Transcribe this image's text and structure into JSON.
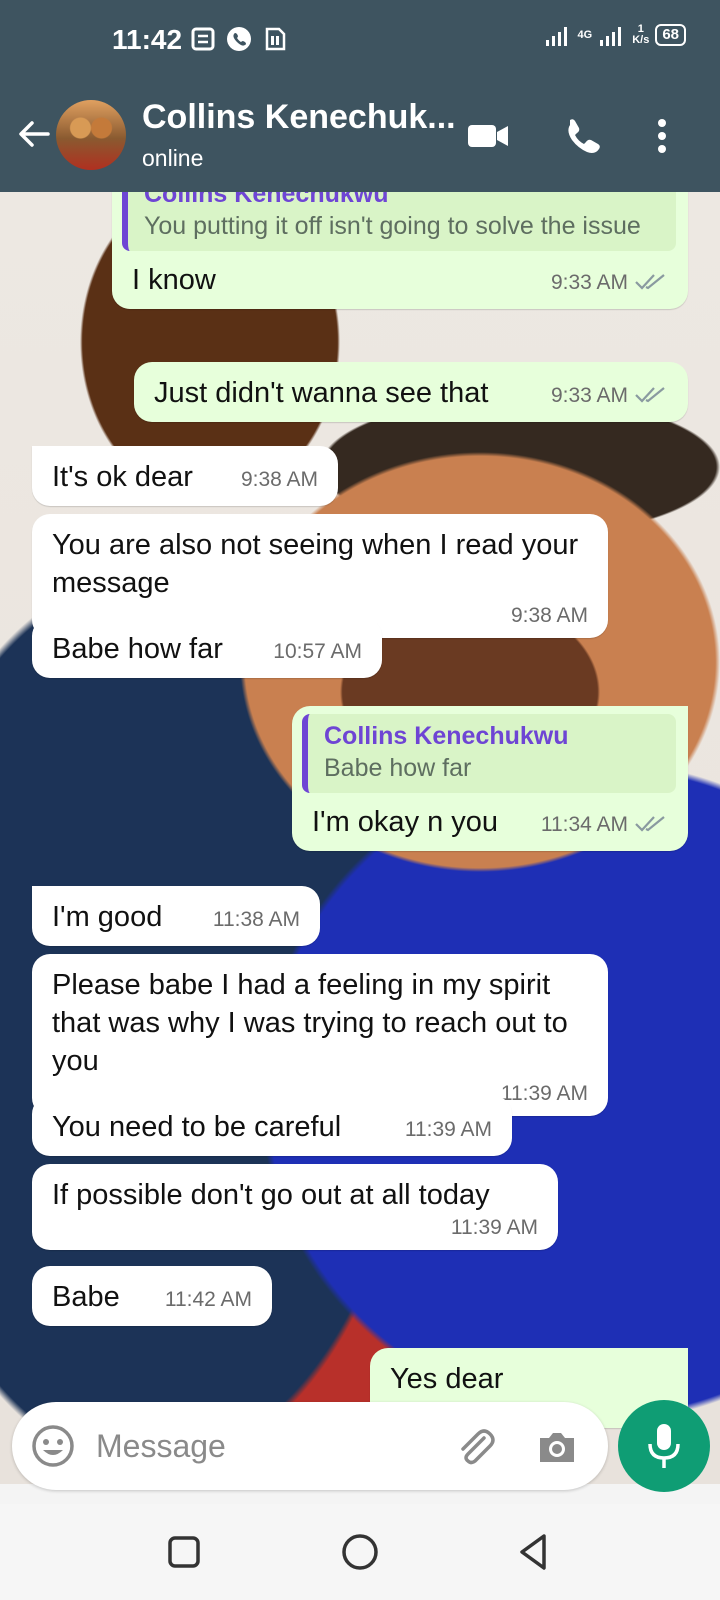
{
  "status_bar": {
    "time": "11:42",
    "network": "4G",
    "speed_value": "1",
    "speed_unit": "K/s",
    "battery": "68",
    "icons": [
      "notes-icon",
      "whatsapp-icon",
      "sim-card-icon",
      "signal-icon",
      "signal-icon"
    ]
  },
  "header": {
    "contact_name": "Collins Kenechuk...",
    "status": "online",
    "actions": [
      "video-call-icon",
      "voice-call-icon",
      "more-options-icon"
    ]
  },
  "messages": [
    {
      "direction": "out",
      "quote": {
        "author": "Collins Kenechukwu",
        "text": "You putting it off isn't going to solve the issue"
      },
      "text": "I know",
      "time": "9:33 AM",
      "read": true
    },
    {
      "direction": "out",
      "text": "Just didn't wanna see that",
      "time": "9:33 AM",
      "read": true
    },
    {
      "direction": "in",
      "text": "It's ok dear",
      "time": "9:38 AM"
    },
    {
      "direction": "in",
      "text": "You are also not seeing when I read your message",
      "time": "9:38 AM"
    },
    {
      "direction": "in",
      "text": "Babe how far",
      "time": "10:57 AM"
    },
    {
      "direction": "out",
      "quote": {
        "author": "Collins Kenechukwu",
        "text": "Babe how far"
      },
      "text": "I'm okay n you",
      "time": "11:34 AM",
      "read": true
    },
    {
      "direction": "in",
      "text": "I'm good",
      "time": "11:38 AM"
    },
    {
      "direction": "in",
      "text": "Please babe I had a feeling in my spirit that was why I was trying to reach out to you",
      "time": "11:39 AM"
    },
    {
      "direction": "in",
      "text": "You need to be careful",
      "time": "11:39 AM"
    },
    {
      "direction": "in",
      "text": "If possible don't go out at all today",
      "time": "11:39 AM"
    },
    {
      "direction": "in",
      "text": "Babe",
      "time": "11:42 AM"
    },
    {
      "direction": "out",
      "text": "Yes dear",
      "partial": true
    }
  ],
  "input": {
    "placeholder": "Message",
    "icons": [
      "emoji-icon",
      "attach-icon",
      "camera-icon",
      "microphone-icon"
    ]
  },
  "nav": {
    "icons": [
      "recents-icon",
      "home-icon",
      "back-icon"
    ]
  },
  "colors": {
    "header": "#3e5460",
    "outgoing_bubble": "#e7ffdb",
    "incoming_bubble": "#ffffff",
    "quote_accent": "#6e45d4",
    "mic_button": "#0f9d74",
    "read_ticks": "#8a9aa0"
  }
}
